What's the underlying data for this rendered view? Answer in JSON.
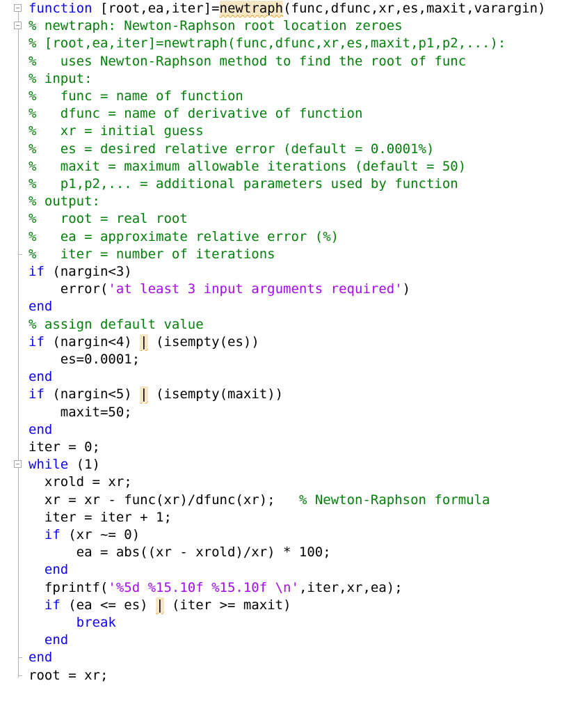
{
  "editor": {
    "language": "MATLAB",
    "colors": {
      "keyword": "#0e00ff",
      "comment": "#028009",
      "string": "#a709f5",
      "text": "#000000",
      "warning_highlight": "#f5e6c4",
      "warning_underline": "#f29a1e"
    },
    "lines": [
      {
        "fold": "open",
        "tokens": [
          [
            "kw",
            "function"
          ],
          [
            "tx",
            " [root,ea,iter]="
          ],
          [
            "warn",
            "newtraph"
          ],
          [
            "tx",
            "(func,dfunc,xr,es,maxit,varargin)"
          ]
        ]
      },
      {
        "fold": "open",
        "tokens": [
          [
            "cm",
            "% newtraph: Newton-Raphson root location zeroes"
          ]
        ]
      },
      {
        "tokens": [
          [
            "cm",
            "% [root,ea,iter]=newtraph(func,dfunc,xr,es,maxit,p1,p2,...):"
          ]
        ]
      },
      {
        "tokens": [
          [
            "cm",
            "%   uses Newton-Raphson method to find the root of func"
          ]
        ]
      },
      {
        "tokens": [
          [
            "cm",
            "% input:"
          ]
        ]
      },
      {
        "tokens": [
          [
            "cm",
            "%   func = name of function"
          ]
        ]
      },
      {
        "tokens": [
          [
            "cm",
            "%   dfunc = name of derivative of function"
          ]
        ]
      },
      {
        "tokens": [
          [
            "cm",
            "%   xr = initial guess"
          ]
        ]
      },
      {
        "tokens": [
          [
            "cm",
            "%   es = desired relative error (default = 0.0001%)"
          ]
        ]
      },
      {
        "tokens": [
          [
            "cm",
            "%   maxit = maximum allowable iterations (default = 50)"
          ]
        ]
      },
      {
        "tokens": [
          [
            "cm",
            "%   p1,p2,... = additional parameters used by function"
          ]
        ]
      },
      {
        "tokens": [
          [
            "cm",
            "% output:"
          ]
        ]
      },
      {
        "tokens": [
          [
            "cm",
            "%   root = real root"
          ]
        ]
      },
      {
        "tokens": [
          [
            "cm",
            "%   ea = approximate relative error (%)"
          ]
        ]
      },
      {
        "fold": "end",
        "tokens": [
          [
            "cm",
            "%   iter = number of iterations"
          ]
        ]
      },
      {
        "tokens": [
          [
            "kw",
            "if"
          ],
          [
            "tx",
            " (nargin<3)"
          ]
        ]
      },
      {
        "tokens": [
          [
            "tx",
            "    error("
          ],
          [
            "st",
            "'at least 3 input arguments required'"
          ],
          [
            "tx",
            ")"
          ]
        ]
      },
      {
        "tokens": [
          [
            "kw",
            "end"
          ]
        ]
      },
      {
        "tokens": [
          [
            "cm",
            "% assign default value"
          ]
        ]
      },
      {
        "tokens": [
          [
            "kw",
            "if"
          ],
          [
            "tx",
            " (nargin<4) "
          ],
          [
            "warn",
            "|"
          ],
          [
            "tx",
            " (isempty(es))"
          ]
        ]
      },
      {
        "tokens": [
          [
            "tx",
            "    es=0.0001;"
          ]
        ]
      },
      {
        "tokens": [
          [
            "kw",
            "end"
          ]
        ]
      },
      {
        "tokens": [
          [
            "kw",
            "if"
          ],
          [
            "tx",
            " (nargin<5) "
          ],
          [
            "warn",
            "|"
          ],
          [
            "tx",
            " (isempty(maxit))"
          ]
        ]
      },
      {
        "tokens": [
          [
            "tx",
            "    maxit=50;"
          ]
        ]
      },
      {
        "tokens": [
          [
            "kw",
            "end"
          ]
        ]
      },
      {
        "tokens": [
          [
            "tx",
            "iter = 0;"
          ]
        ]
      },
      {
        "fold": "open",
        "tokens": [
          [
            "kw",
            "while"
          ],
          [
            "tx",
            " (1)"
          ]
        ]
      },
      {
        "tokens": [
          [
            "tx",
            "  xrold = xr;"
          ]
        ]
      },
      {
        "tokens": [
          [
            "tx",
            "  xr = xr - func(xr)/dfunc(xr);   "
          ],
          [
            "cm",
            "% Newton-Raphson formula"
          ]
        ]
      },
      {
        "tokens": [
          [
            "tx",
            "  iter = iter + 1;"
          ]
        ]
      },
      {
        "tokens": [
          [
            "tx",
            "  "
          ],
          [
            "kw",
            "if"
          ],
          [
            "tx",
            " (xr ~= 0)"
          ]
        ]
      },
      {
        "tokens": [
          [
            "tx",
            "      ea = abs((xr - xrold)/xr) * 100;"
          ]
        ]
      },
      {
        "tokens": [
          [
            "tx",
            "  "
          ],
          [
            "kw",
            "end"
          ]
        ]
      },
      {
        "tokens": [
          [
            "tx",
            "  fprintf("
          ],
          [
            "st",
            "'%5d %15.10f %15.10f \\n'"
          ],
          [
            "tx",
            ",iter,xr,ea);"
          ]
        ]
      },
      {
        "tokens": [
          [
            "tx",
            "  "
          ],
          [
            "kw",
            "if"
          ],
          [
            "tx",
            " (ea <= es) "
          ],
          [
            "warn",
            "|"
          ],
          [
            "tx",
            " (iter >= maxit)"
          ]
        ]
      },
      {
        "tokens": [
          [
            "tx",
            "      "
          ],
          [
            "kw",
            "break"
          ]
        ]
      },
      {
        "tokens": [
          [
            "tx",
            "  "
          ],
          [
            "kw",
            "end"
          ]
        ]
      },
      {
        "fold": "end",
        "tokens": [
          [
            "kw",
            "end"
          ]
        ]
      },
      {
        "fold": "last",
        "tokens": [
          [
            "tx",
            "root = xr;"
          ]
        ]
      }
    ]
  }
}
